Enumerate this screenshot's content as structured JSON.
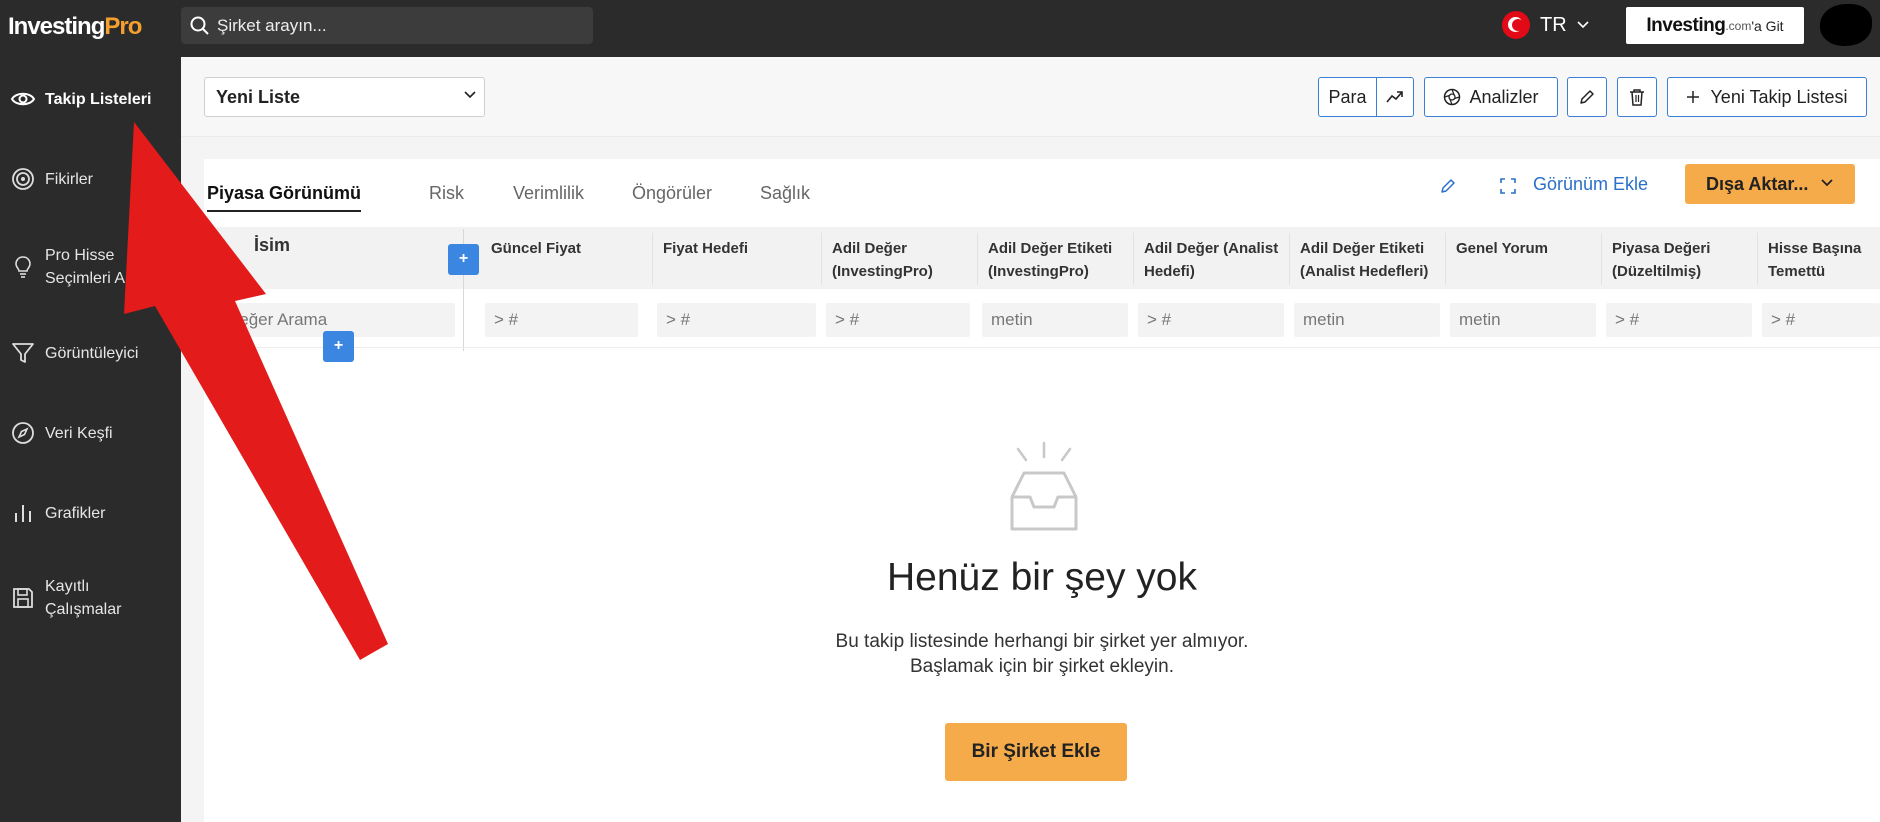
{
  "app": {
    "logo_part1": "Investing",
    "logo_part2": "Pro",
    "logo_accent": "#f5a02e"
  },
  "search": {
    "placeholder": "Şirket arayın..."
  },
  "lang": {
    "code": "TR"
  },
  "goto_site": {
    "brand": "Investing",
    "domain": ".com",
    "suffix": "'a Git"
  },
  "sidebar": {
    "items": [
      {
        "label": "Takip Listeleri",
        "icon": "eye-icon",
        "active": true
      },
      {
        "label": "Fikirler",
        "icon": "target-icon"
      },
      {
        "label": "Pro Hisse Seçimleri AI",
        "label_line1": "Pro Hisse",
        "label_line2": "Seçimleri AI",
        "icon": "lightbulb-icon"
      },
      {
        "label": "Görüntüleyici",
        "icon": "filter-icon"
      },
      {
        "label": "Veri Keşfi",
        "icon": "compass-icon"
      },
      {
        "label": "Grafikler",
        "icon": "bar-chart-icon"
      },
      {
        "label": "Kayıtlı Çalışmalar",
        "label_line1": "Kayıtlı",
        "label_line2": "Çalışmalar",
        "icon": "save-icon"
      }
    ]
  },
  "header": {
    "list_select": "Yeni Liste",
    "currency_button": "Para",
    "analyses_button": "Analizler",
    "new_list_button": "Yeni Takip Listesi"
  },
  "tabs": [
    "Piyasa Görünümü",
    "Risk",
    "Verimlilik",
    "Öngörüler",
    "Sağlık"
  ],
  "toolbar": {
    "add_view": "Görünüm Ekle",
    "export": "Dışa Aktar..."
  },
  "table": {
    "name_column": "İsim",
    "name_filter_placeholder": "Değer Arama",
    "columns": [
      {
        "line1": "Güncel Fiyat",
        "line2": "",
        "filter": "> #"
      },
      {
        "line1": "Fiyat Hedefi",
        "line2": "",
        "filter": "> #"
      },
      {
        "line1": "Adil Değer",
        "line2": "(InvestingPro)",
        "filter": "> #"
      },
      {
        "line1": "Adil Değer Etiketi",
        "line2": "(InvestingPro)",
        "filter": "metin"
      },
      {
        "line1": "Adil Değer (Analist",
        "line2": "Hedefi)",
        "filter": "> #"
      },
      {
        "line1": "Adil Değer Etiketi",
        "line2": "(Analist Hedefleri)",
        "filter": "metin"
      },
      {
        "line1": "Genel Yorum",
        "line2": "",
        "filter": "metin"
      },
      {
        "line1": "Piyasa Değeri",
        "line2": "(Düzeltilmiş)",
        "filter": "> #"
      },
      {
        "line1": "Hisse Başına",
        "line2": "Temettü",
        "filter": "> #"
      }
    ]
  },
  "empty": {
    "title": "Henüz bir şey yok",
    "text_line1": "Bu takip listesinde herhangi bir şirket yer almıyor.",
    "text_line2": "Başlamak için bir şirket ekleyin.",
    "button": "Bir Şirket Ekle"
  },
  "colors": {
    "accent_orange": "#f5ab4a",
    "link_blue": "#2a6fc9",
    "annotation_red": "#e31b1b"
  }
}
